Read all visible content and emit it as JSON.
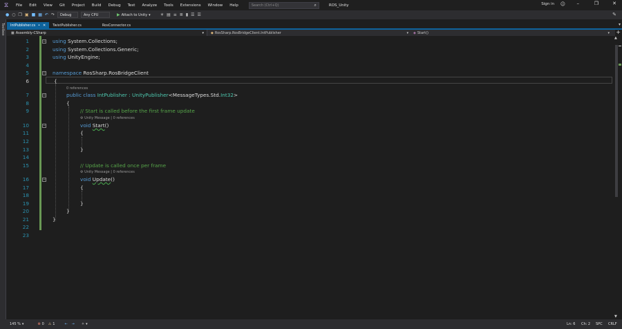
{
  "menubar": {
    "items": [
      "File",
      "Edit",
      "View",
      "Git",
      "Project",
      "Build",
      "Debug",
      "Test",
      "Analyze",
      "Tools",
      "Extensions",
      "Window",
      "Help"
    ],
    "search_placeholder": "Search (Ctrl+Q)",
    "solution_name": "ROS_Unity",
    "signin": "Sign in"
  },
  "toolbar": {
    "config": "Debug",
    "platform": "Any CPU",
    "attach": "Attach to Unity"
  },
  "toolbox_label": "Toolbox",
  "tabs": [
    {
      "label": "IntPublisher.cs",
      "active": true
    },
    {
      "label": "TwistPublisher.cs",
      "active": false
    },
    {
      "label": "RosConnector.cs",
      "active": false
    }
  ],
  "nav": {
    "project": "Assembly-CSharp",
    "class": "RosSharp.RosBridgeClient.IntPublisher",
    "member": "Start()"
  },
  "editor": {
    "lines": [
      "1",
      "2",
      "3",
      "4",
      "5",
      "6",
      "7",
      "8",
      "9",
      "10",
      "11",
      "12",
      "13",
      "14",
      "15",
      "16",
      "17",
      "18",
      "19",
      "20",
      "21",
      "22",
      "23"
    ],
    "line1": {
      "kw": "using",
      "rest": " System.Collections;"
    },
    "line2": {
      "kw": "using",
      "rest": " System.Collections.Generic;"
    },
    "line3": {
      "kw": "using",
      "rest": " UnityEngine;"
    },
    "line5": {
      "kw": "namespace",
      "rest": " RosSharp.RosBridgeClient"
    },
    "line6": "{",
    "lens7": "0 references",
    "line7": {
      "kw1": "public",
      "kw2": "class",
      "name": " IntPublisher : ",
      "base": "UnityPublisher",
      "lt": "<",
      "gen": "MessageTypes.Std.",
      "int": "Int32",
      "gt": ">"
    },
    "line8": "{",
    "line9": "// Start is called before the first frame update",
    "lens10": "Unity Message | 0 references",
    "line10": {
      "kw": "void",
      "name": "Start",
      "paren": "()"
    },
    "line11": "{",
    "line13": "}",
    "line15": "// Update is called once per frame",
    "lens16": "Unity Message | 0 references",
    "line16": {
      "kw": "void",
      "name": "Update",
      "paren": "()"
    },
    "line17": "{",
    "line19": "}",
    "line20": "}",
    "line21": "}"
  },
  "status": {
    "zoom": "145 %",
    "errors": "0",
    "warnings": "1",
    "ln": "Ln: 6",
    "ch": "Ch: 2",
    "spc": "SPC",
    "crlf": "CRLF"
  },
  "colors": {
    "accent": "#0e639c",
    "keyword": "#569cd6",
    "type": "#4ec9b0",
    "comment": "#57a64a",
    "line_number": "#2b91af"
  }
}
